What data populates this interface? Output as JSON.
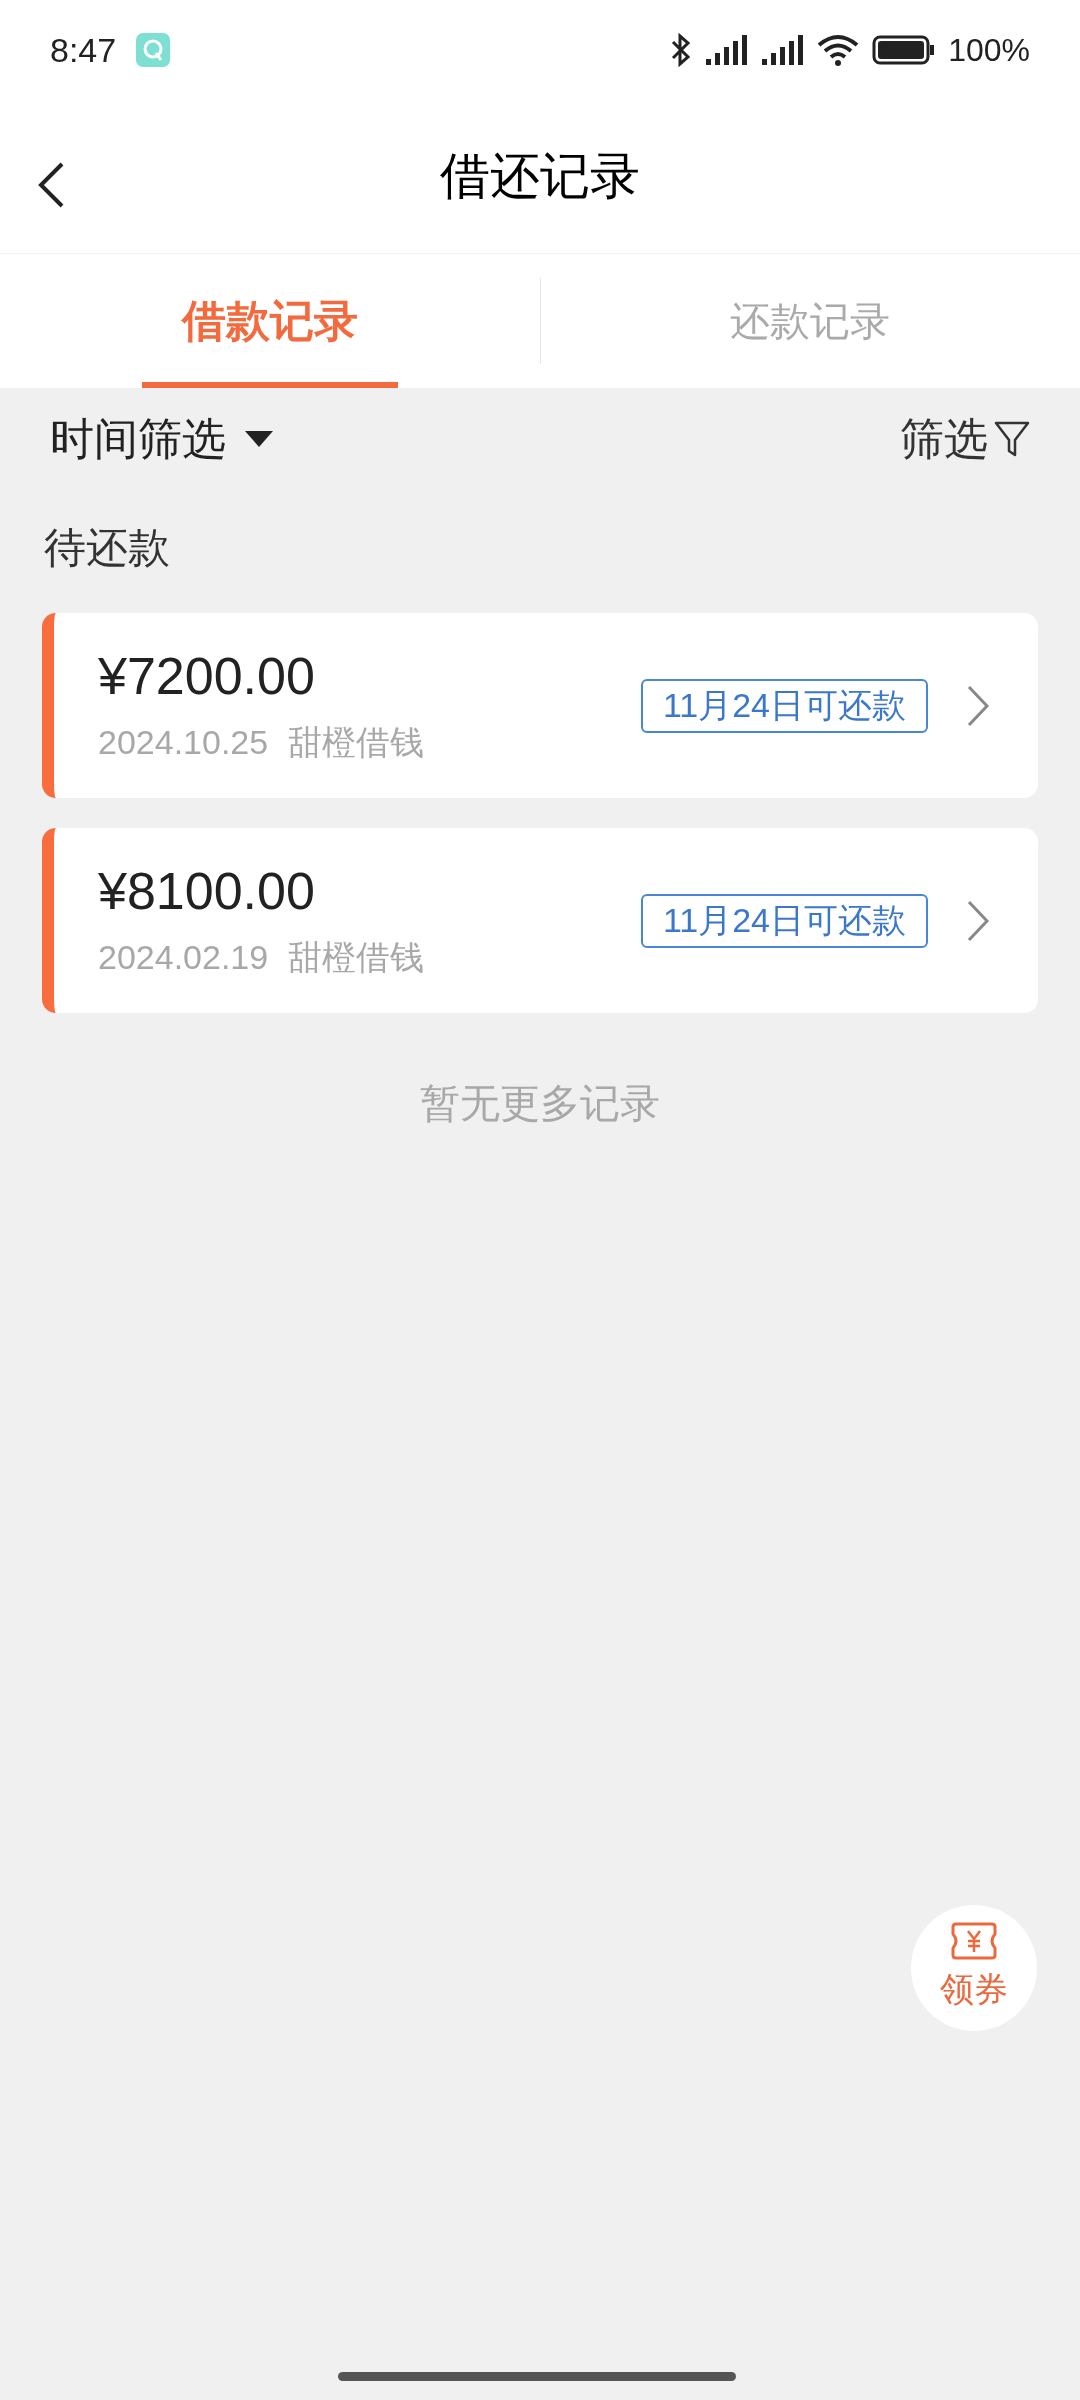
{
  "status_bar": {
    "time": "8:47",
    "battery": "100%"
  },
  "header": {
    "title": "借还记录"
  },
  "tabs": [
    {
      "label": "借款记录",
      "selected": true
    },
    {
      "label": "还款记录",
      "selected": false
    }
  ],
  "filters": {
    "time_filter": "时间筛选",
    "filter": "筛选"
  },
  "section_title": "待还款",
  "loans": [
    {
      "amount": "¥7200.00",
      "date": "2024.10.25",
      "lender": "甜橙借钱",
      "badge": "11月24日可还款"
    },
    {
      "amount": "¥8100.00",
      "date": "2024.02.19",
      "lender": "甜橙借钱",
      "badge": "11月24日可还款"
    }
  ],
  "end_note": "暂无更多记录",
  "coupon_button": {
    "label": "领券"
  }
}
